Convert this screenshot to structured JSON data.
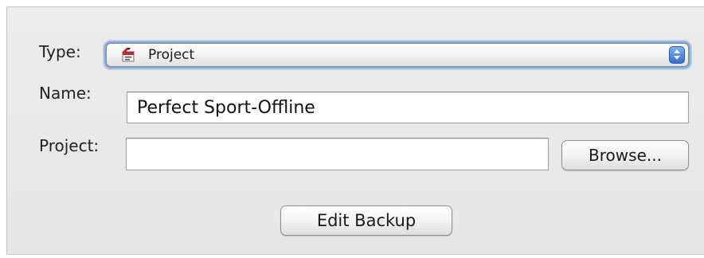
{
  "dialog": {
    "type": {
      "label": "Type:",
      "value": "Project",
      "icon": "project-document-icon"
    },
    "name": {
      "label": "Name:",
      "value": "Perfect Sport-Offline",
      "placeholder": ""
    },
    "project": {
      "label": "Project:",
      "value": "",
      "placeholder": "",
      "browse_label": "Browse..."
    },
    "edit_backup_label": "Edit Backup"
  },
  "colors": {
    "focus_ring": "#7ea8e0",
    "stepper_blue": "#2f6fd9",
    "panel_background": "#ececec"
  }
}
